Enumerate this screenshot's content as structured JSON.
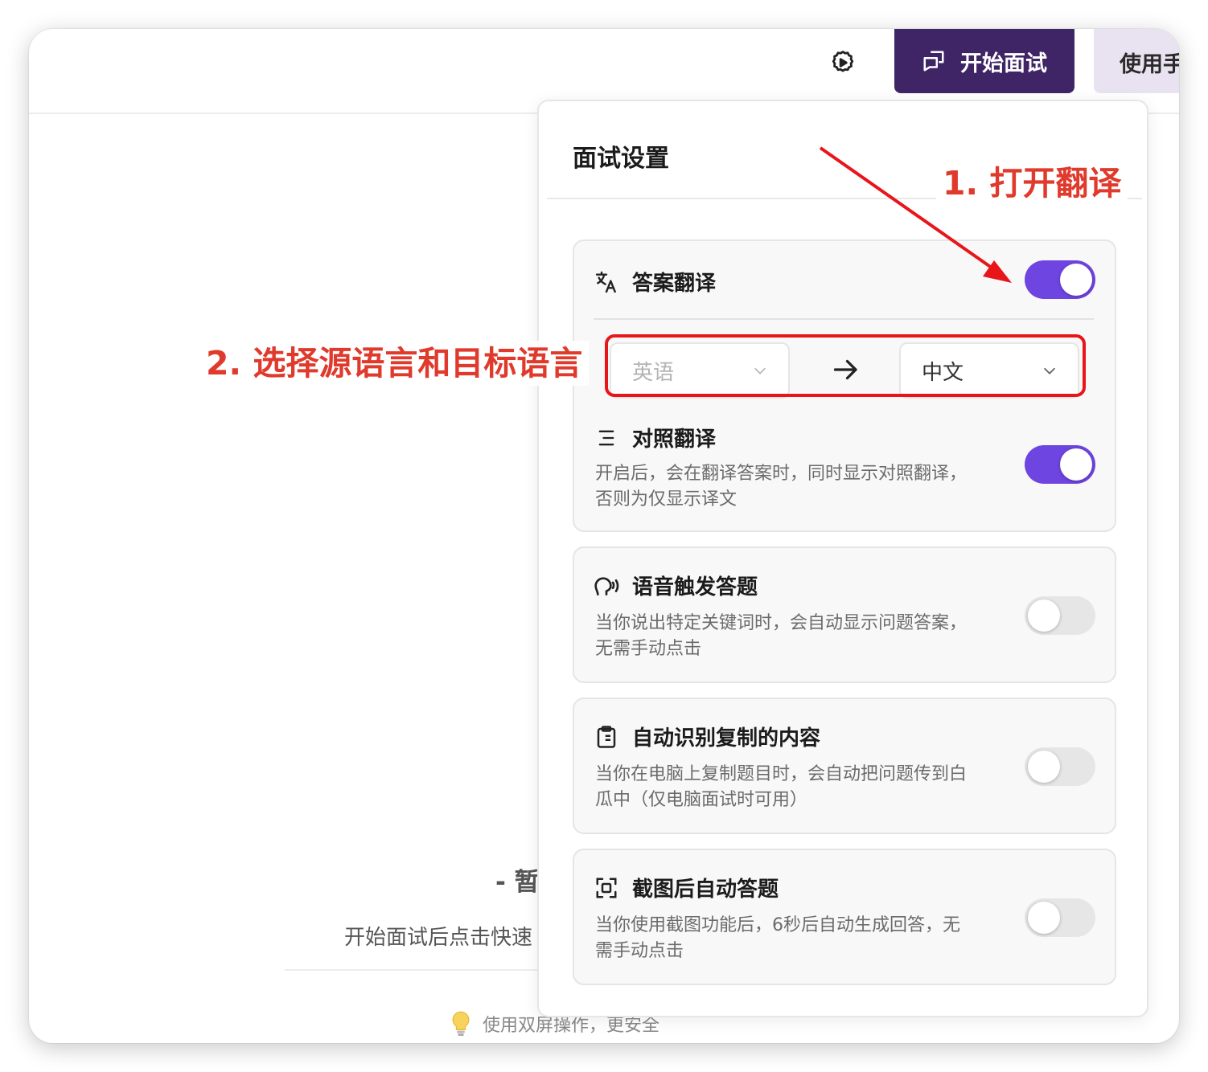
{
  "header": {
    "start_interview_label": "开始面试",
    "manual_label": "使用手册",
    "settings_icon": "gear-icon",
    "start_icon": "chat-icon"
  },
  "background": {
    "empty_title": "- 暂",
    "empty_hint": "开始面试后点击快速",
    "tip": "使用双屏操作，更安全",
    "tip_icon": "lightbulb-icon"
  },
  "settings": {
    "title": "面试设置",
    "answer_translation": {
      "icon": "translate-icon",
      "title": "答案翻译",
      "enabled": true,
      "source_language": "英语",
      "target_language": "中文",
      "arrow_icon": "arrow-right-icon"
    },
    "contrast_translation": {
      "icon": "list-icon",
      "title": "对照翻译",
      "description": "开启后，会在翻译答案时，同时显示对照翻译，否则为仅显示译文",
      "enabled": true
    },
    "voice_trigger": {
      "icon": "voice-icon",
      "title": "语音触发答题",
      "description": "当你说出特定关键词时，会自动显示问题答案，无需手动点击",
      "enabled": false
    },
    "clipboard_detect": {
      "icon": "clipboard-icon",
      "title": "自动识别复制的内容",
      "description": "当你在电脑上复制题目时，会自动把问题传到白瓜中（仅电脑面试时可用）",
      "enabled": false
    },
    "screenshot_answer": {
      "icon": "screenshot-icon",
      "title": "截图后自动答题",
      "description": "当你使用截图功能后，6秒后自动生成回答，无需手动点击",
      "enabled": false
    }
  },
  "annotations": {
    "step1": "1. 打开翻译",
    "step2": "2. 选择源语言和目标语言",
    "color": "#e03a2c"
  },
  "colors": {
    "primary": "#3f2466",
    "toggle_on": "#6e45e0",
    "manual_bg": "#e9e2f0"
  }
}
